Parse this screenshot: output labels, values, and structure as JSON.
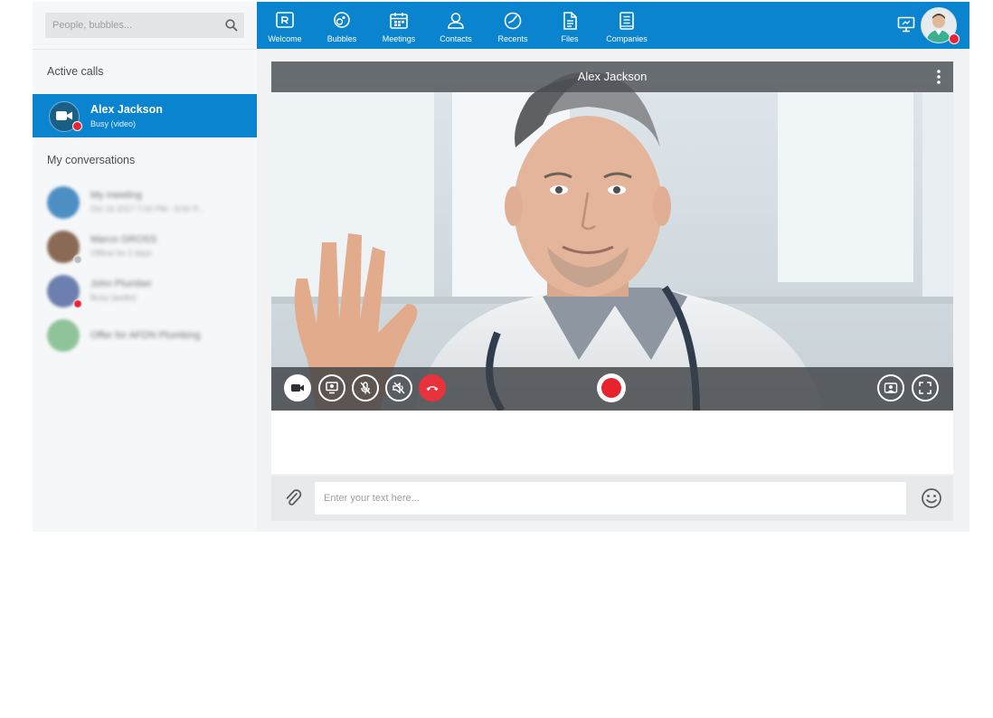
{
  "search": {
    "placeholder": "People, bubbles..."
  },
  "sidebar": {
    "active_calls_title": "Active calls",
    "active_call": {
      "name": "Alex Jackson",
      "status": "Busy (video)"
    },
    "conversations_title": "My conversations",
    "conversations": [
      {
        "name": "My meeting",
        "sub": "Oct 16 2017 7:00 PM - 8:00 P...",
        "color": "#4d8fc4"
      },
      {
        "name": "Marco GROSS",
        "sub": "Offline for 2 days",
        "color": "#8a6a55"
      },
      {
        "name": "John Plumber",
        "sub": "Busy (audio)",
        "color": "#6c7fae"
      },
      {
        "name": "Offer for AFDN Plumbing",
        "sub": "",
        "color": "#8fc49a"
      }
    ]
  },
  "nav": [
    {
      "label": "Welcome",
      "icon": "welcome-icon"
    },
    {
      "label": "Bubbles",
      "icon": "bubbles-icon"
    },
    {
      "label": "Meetings",
      "icon": "calendar-icon"
    },
    {
      "label": "Contacts",
      "icon": "contacts-icon"
    },
    {
      "label": "Recents",
      "icon": "recents-icon"
    },
    {
      "label": "Files",
      "icon": "files-icon"
    },
    {
      "label": "Companies",
      "icon": "companies-icon"
    }
  ],
  "video": {
    "title": "Alex Jackson"
  },
  "composer": {
    "placeholder": "Enter your text here..."
  },
  "colors": {
    "brand": "#0a84ce",
    "busy": "#e8243a",
    "hangup": "#e8323c"
  }
}
